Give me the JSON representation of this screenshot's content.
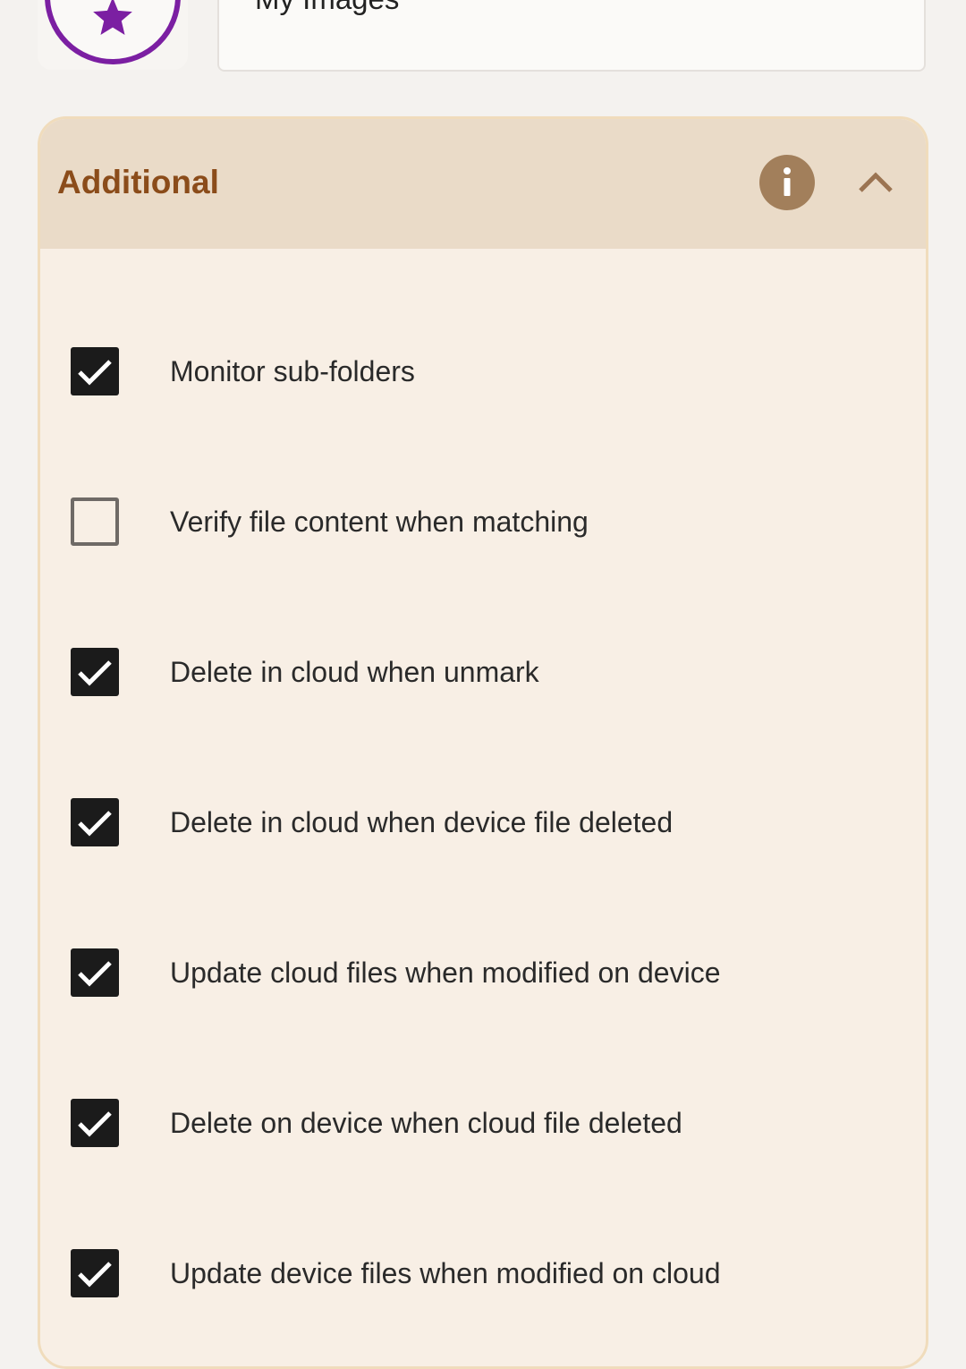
{
  "folder": {
    "icon": "star-icon",
    "icon_color": "#7b1fa2",
    "name": "My Images"
  },
  "additional": {
    "title": "Additional",
    "title_color": "#8b4c1a",
    "info_icon": "info-icon",
    "collapse_icon": "chevron-up-icon",
    "expanded": true,
    "options": [
      {
        "label": "Monitor sub-folders",
        "checked": true
      },
      {
        "label": "Verify file content when matching",
        "checked": false
      },
      {
        "label": "Delete in cloud when unmark",
        "checked": true
      },
      {
        "label": "Delete in cloud when device file deleted",
        "checked": true
      },
      {
        "label": "Update cloud files when modified on device",
        "checked": true
      },
      {
        "label": "Delete on device when cloud file deleted",
        "checked": true
      },
      {
        "label": "Update device files when modified on cloud",
        "checked": true
      }
    ]
  }
}
